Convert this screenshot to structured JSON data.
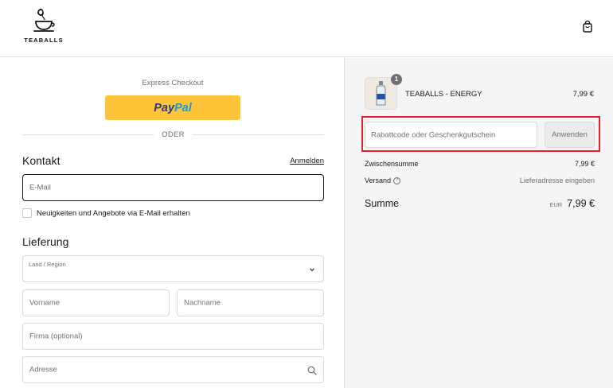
{
  "header": {
    "brand": "TEABALLS",
    "icons": {
      "logo": "teacup-logo-icon",
      "cart": "shopping-bag-icon"
    }
  },
  "checkout": {
    "express_title": "Express Checkout",
    "paypal": {
      "part1": "Pay",
      "part2": "Pal",
      "bg_color": "#ffc439"
    },
    "divider_text": "ODER",
    "contact": {
      "title": "Kontakt",
      "login_link": "Anmelden",
      "email_placeholder": "E-Mail",
      "newsletter_label": "Neuigkeiten und Angebote via E-Mail erhalten"
    },
    "delivery": {
      "title": "Lieferung",
      "country_label": "Land / Region",
      "first_name_placeholder": "Vorname",
      "last_name_placeholder": "Nachname",
      "company_placeholder": "Firma (optional)",
      "address_placeholder": "Adresse"
    }
  },
  "summary": {
    "product": {
      "quantity": "1",
      "name": "TEABALLS - ENERGY",
      "price": "7,99 €"
    },
    "discount": {
      "placeholder": "Rabattcode oder Geschenkgutschein",
      "apply_label": "Anwenden",
      "highlight_color": "#d9262c"
    },
    "subtotal_label": "Zwischensumme",
    "subtotal_value": "7,99 €",
    "shipping_label": "Versand",
    "shipping_value": "Lieferadresse eingeben",
    "total_label": "Summe",
    "total_currency": "EUR",
    "total_value": "7,99 €"
  }
}
